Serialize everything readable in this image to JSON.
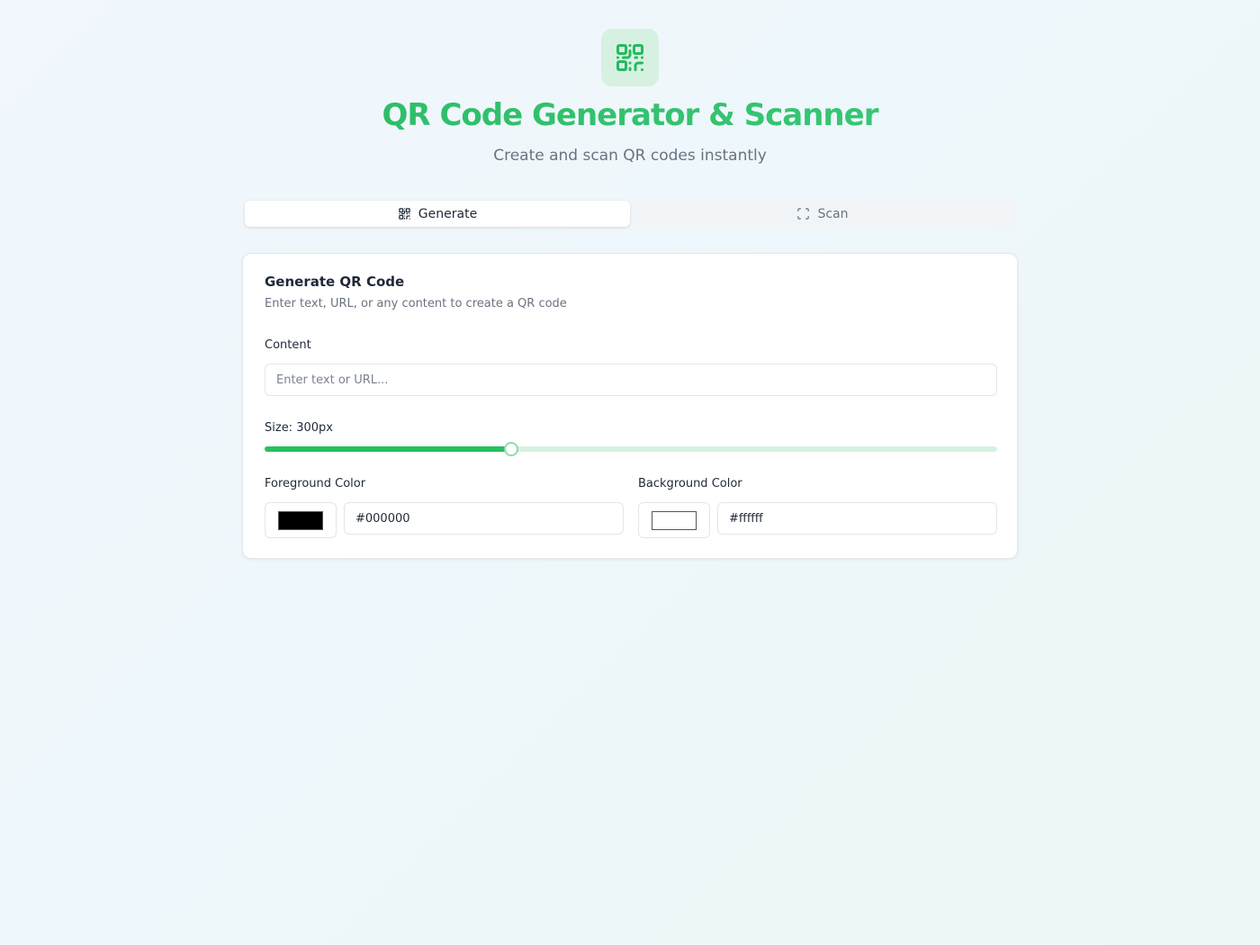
{
  "header": {
    "logo_icon": "qr-code-icon",
    "title": "QR Code Generator & Scanner",
    "subtitle": "Create and scan QR codes instantly"
  },
  "tabs": [
    {
      "label": "Generate",
      "icon": "qr-code-icon",
      "active": true
    },
    {
      "label": "Scan",
      "icon": "scan-frame-icon",
      "active": false
    }
  ],
  "card": {
    "title": "Generate QR Code",
    "description": "Enter text, URL, or any content to create a QR code",
    "content_label": "Content",
    "content_value": "",
    "content_placeholder": "Enter text or URL...",
    "size_label": "Size: 300px",
    "size_value": 300,
    "foreground_label": "Foreground Color",
    "foreground_value": "#000000",
    "background_label": "Background Color",
    "background_value": "#ffffff"
  },
  "colors": {
    "accent": "#27c060",
    "accent_light": "#d5f2e0"
  }
}
